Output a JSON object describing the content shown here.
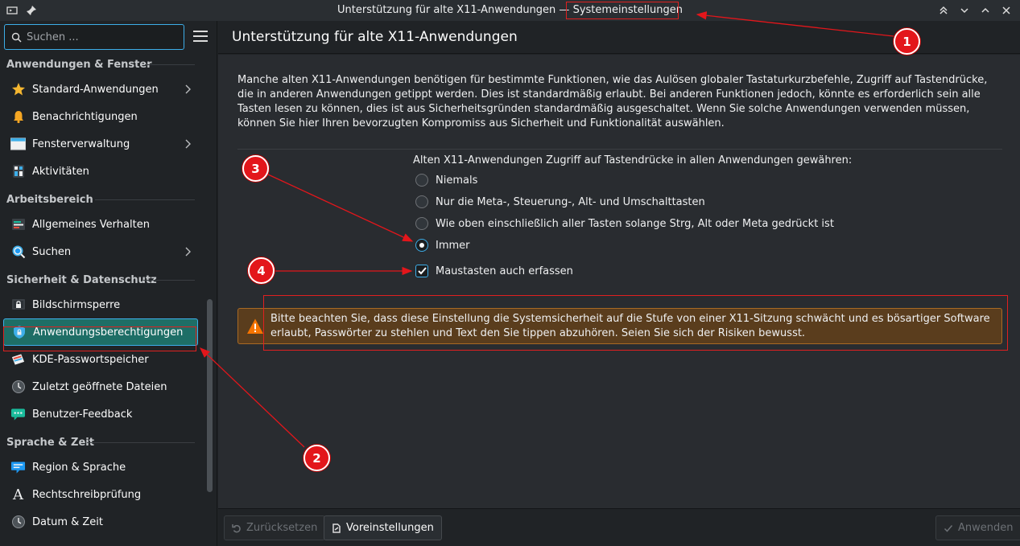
{
  "window": {
    "title_prefix": "Unterstützung für alte X11-Anwendungen — ",
    "title_app": "Systemeinstellungen"
  },
  "sidebar": {
    "search_placeholder": "Suchen ...",
    "sections": [
      {
        "heading": "Anwendungen & Fenster",
        "items": [
          {
            "label": "Standard-Anwendungen",
            "icon": "star-icon",
            "has_children": true
          },
          {
            "label": "Benachrichtigungen",
            "icon": "bell-icon",
            "has_children": false
          },
          {
            "label": "Fensterverwaltung",
            "icon": "window-icon",
            "has_children": true
          },
          {
            "label": "Aktivitäten",
            "icon": "activities-icon",
            "has_children": false
          }
        ]
      },
      {
        "heading": "Arbeitsbereich",
        "items": [
          {
            "label": "Allgemeines Verhalten",
            "icon": "general-behavior-icon",
            "has_children": false
          },
          {
            "label": "Suchen",
            "icon": "search-icon",
            "has_children": true
          }
        ]
      },
      {
        "heading": "Sicherheit & Datenschutz",
        "items": [
          {
            "label": "Bildschirmsperre",
            "icon": "screen-lock-icon",
            "has_children": false
          },
          {
            "label": "Anwendungsberechtigungen",
            "icon": "app-permissions-icon",
            "has_children": false,
            "active": true
          },
          {
            "label": "KDE-Passwortspeicher",
            "icon": "wallet-icon",
            "has_children": false
          },
          {
            "label": "Zuletzt geöffnete Dateien",
            "icon": "clock-icon",
            "has_children": false
          },
          {
            "label": "Benutzer-Feedback",
            "icon": "feedback-icon",
            "has_children": false
          }
        ]
      },
      {
        "heading": "Sprache & Zeit",
        "items": [
          {
            "label": "Region & Sprache",
            "icon": "region-icon",
            "has_children": false
          },
          {
            "label": "Rechtschreibprüfung",
            "icon": "spellcheck-icon",
            "has_children": false
          },
          {
            "label": "Datum & Zeit",
            "icon": "clock-icon",
            "has_children": false
          }
        ]
      }
    ]
  },
  "main": {
    "page_title": "Unterstützung für alte X11-Anwendungen",
    "description": "Manche alten X11-Anwendungen benötigen für bestimmte Funktionen, wie das Aulösen globaler Tastaturkurzbefehle, Zugriff auf Tastendrücke, die in anderen Anwendungen getippt werden. Dies ist standardmäßig erlaubt. Bei anderen Funktionen jedoch, könnte es erforderlich sein alle Tasten lesen zu können, dies ist aus Sicherheitsgründen standardmäßig ausgeschaltet. Wenn Sie solche Anwendungen verwenden müssen, können Sie hier Ihren bevorzugten Kompromiss aus Sicherheit und Funktionalität auswählen.",
    "option_title": "Alten X11-Anwendungen Zugriff auf Tastendrücke in allen Anwendungen gewähren:",
    "radio_options": [
      {
        "label": "Niemals",
        "selected": false
      },
      {
        "label": "Nur die Meta-, Steuerung-, Alt- und Umschalttasten",
        "selected": false
      },
      {
        "label": "Wie oben einschließlich aller Tasten solange Strg, Alt oder Meta gedrückt ist",
        "selected": false
      },
      {
        "label": "Immer",
        "selected": true
      }
    ],
    "checkbox": {
      "label": "Maustasten auch erfassen",
      "checked": true
    },
    "warning": "Bitte beachten Sie, dass diese Einstellung die Systemsicherheit auf die Stufe von einer X11-Sitzung schwächt und es bösartiger Software erlaubt, Passwörter zu stehlen und Text den Sie tippen abzuhören. Seien Sie sich der Risiken bewusst."
  },
  "footer": {
    "reset_label": "Zurücksetzen",
    "defaults_label": "Voreinstellungen",
    "apply_label": "Anwenden"
  },
  "annotations": {
    "badge_1": "1",
    "badge_2": "2",
    "badge_3": "3",
    "badge_4": "4",
    "color": "#e3161b"
  },
  "colors": {
    "accent": "#3daee9",
    "active_item": "#1e6e66",
    "warning_bg": "#5a3d1d"
  }
}
